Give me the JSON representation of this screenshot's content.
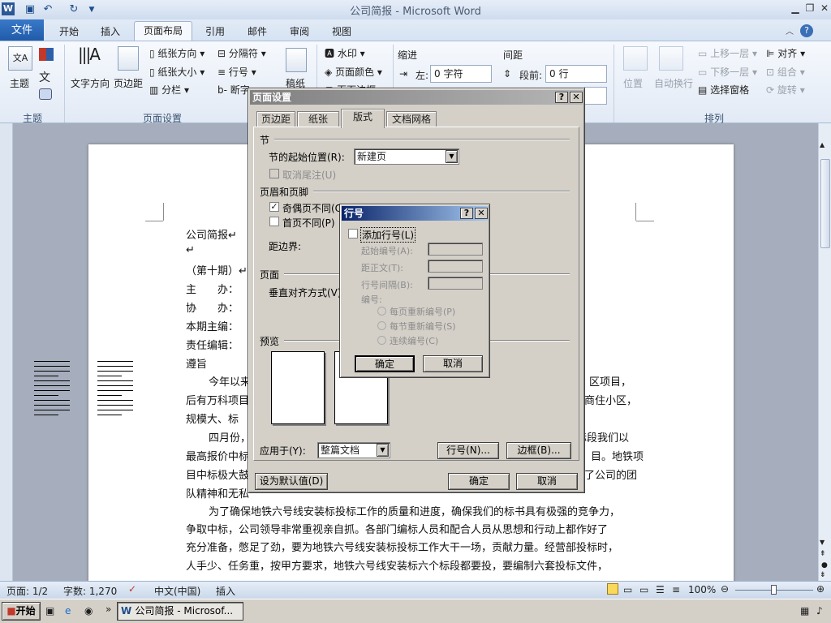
{
  "window": {
    "title": "公司简报 - Microsoft Word"
  },
  "ribbon_tabs": [
    "文件",
    "开始",
    "插入",
    "页面布局",
    "引用",
    "邮件",
    "审阅",
    "视图"
  ],
  "ribbon": {
    "theme_group": "主题",
    "theme_btn": "主题",
    "page_setup_group": "页面设置",
    "text_dir": "文字方向",
    "margins": "页边距",
    "orientation": "纸张方向",
    "size": "纸张大小",
    "columns": "分栏",
    "breaks": "分隔符",
    "line_numbers": "行号",
    "hyphenation": "断字",
    "draft": "稿纸",
    "watermark": "水印",
    "page_color": "页面颜色",
    "page_border": "页面边框",
    "indent_title": "缩进",
    "indent_left_label": "左:",
    "indent_left_value": "0 字符",
    "spacing_title": "间距",
    "spacing_before_label": "段前:",
    "spacing_before_value": "0 行",
    "position": "位置",
    "wrap": "自动换行",
    "bring_forward": "上移一层",
    "send_backward": "下移一层",
    "selection_pane": "选择窗格",
    "align": "对齐",
    "group": "组合",
    "rotate": "旋转",
    "arrange_group": "排列"
  },
  "document": {
    "lines": [
      "公司简报↵",
      "↵",
      "（第十期）↵",
      "主　　办：",
      "协　　办：",
      "本期主编：",
      "责任编辑：",
      "遵旨",
      "今年以来",
      "后有万科项目",
      "规模大、标",
      "四月份，",
      "最高报价中标",
      "目中标极大鼓",
      "队精神和无私",
      "为了确保地铁六号线安装标投标工作的质量和进度，确保我们的标书具有极强的竞争力，",
      "争取中标，公司领导非常重视亲自抓。各部门编标人员和配合人员从思想和行动上都作好了",
      "充分准备，憋足了劲，要为地铁六号线安装标投标工作大干一场，贡献力量。经营部投标时，",
      "人手少、任务重，按甲方要求，地铁六号线安装标六个标段都要投，要编制六套投标文件，"
    ],
    "right_fragments": [
      "区项目，",
      "商住小区，",
      "标段我们以",
      "目。地铁项",
      "了公司的团"
    ]
  },
  "page_setup_dialog": {
    "title": "页面设置",
    "tabs": [
      "页边距",
      "纸张",
      "版式",
      "文档网格"
    ],
    "section_header": "节",
    "section_start_label": "节的起始位置(R):",
    "section_start_value": "新建页",
    "suppress_endnotes": "取消尾注(U)",
    "header_footer_header": "页眉和页脚",
    "odd_even_label": "奇偶页不同(O)",
    "first_page_label": "首页不同(P)",
    "from_edge_label": "距边界:",
    "page_header": "页面",
    "vertical_align_label": "垂直对齐方式(V):",
    "preview_header": "预览",
    "apply_to_label": "应用于(Y):",
    "apply_to_value": "整篇文档",
    "line_numbers_btn": "行号(N)...",
    "borders_btn": "边框(B)...",
    "set_default_btn": "设为默认值(D)",
    "ok": "确定",
    "cancel": "取消"
  },
  "line_numbers_dialog": {
    "title": "行号",
    "add_label": "添加行号(L)",
    "start_at_label": "起始编号(A):",
    "from_text_label": "距正文(T):",
    "count_by_label": "行号间隔(B):",
    "numbering_label": "编号:",
    "restart_page": "每页重新编号(P)",
    "restart_section": "每节重新编号(S)",
    "continuous": "连续编号(C)",
    "ok": "确定",
    "cancel": "取消"
  },
  "status_bar": {
    "page": "页面: 1/2",
    "words": "字数: 1,270",
    "language": "中文(中国)",
    "insert_mode": "插入",
    "zoom": "100%"
  },
  "taskbar": {
    "start": "开始",
    "task": "公司简报 - Microsof..."
  },
  "colors": {
    "dialog_title_active": "#0a246a",
    "dialog_face": "#d4d0c8",
    "file_tab": "#2a66b8"
  }
}
